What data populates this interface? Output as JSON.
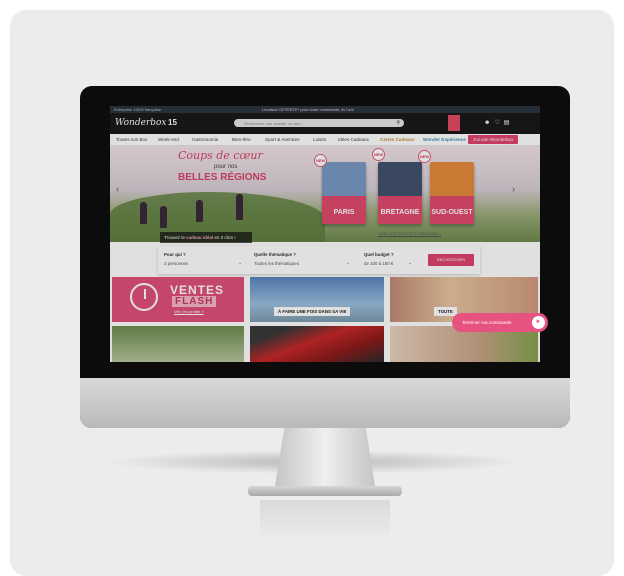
{
  "colors": {
    "brand_pink": "#e0446f",
    "header_dark": "#1a1a1a",
    "nav_gold": "#c2903a",
    "nav_blue": "#3e8fb7"
  },
  "site": {
    "topbar_left": "Entreprise 100% française",
    "topbar_center": "Livraison OFFERTE* pour toute commande, ils l'ont",
    "logo": "Wonderbox",
    "years": "15",
    "search_placeholder": "Rechercher une activité, un lieu...",
    "icons": [
      "user-icon",
      "heart-icon",
      "cart-icon"
    ]
  },
  "nav": {
    "items": [
      "Toutes nos Box",
      "Week-end",
      "Gastronomie",
      "Bien-être",
      "Sport & Aventure",
      "Loisirs",
      "Idées Cadeaux",
      "Cartes Cadeaux",
      "Wonder Expérience"
    ],
    "cta": "J'ai une Wonderbox"
  },
  "hero": {
    "headline_1": "Coups de cœur",
    "headline_2": "pour nos",
    "headline_3": "BELLES RÉGIONS",
    "badge": "NEW",
    "books": [
      "PARIS",
      "BRETAGNE",
      "SUD-OUEST"
    ],
    "link": "VOIR LES COFFRETS RÉGIONS ›",
    "tagline_pre": "Trouvez le",
    "tagline_bold": "cadeau idéal",
    "tagline_post": "en 3 clics !"
  },
  "finder": {
    "q1_label": "Pour qui ?",
    "q1_value": "2 personnes",
    "q2_label": "Quelle thématique ?",
    "q2_value": "Toutes les thématiques",
    "q3_label": "Quel budget ?",
    "q3_value": "de 100 à 150 €",
    "button": "RECHERCHER"
  },
  "tiles": {
    "flash_1": "VENTES",
    "flash_2": "FLASH",
    "flash_link": "Vite j'en profite »",
    "skydive_label": "À FAIRE UNE FOIS DANS SA VIE",
    "party_label": "TOUTE"
  },
  "chat_pill": {
    "label": "Terminer ma commande"
  }
}
